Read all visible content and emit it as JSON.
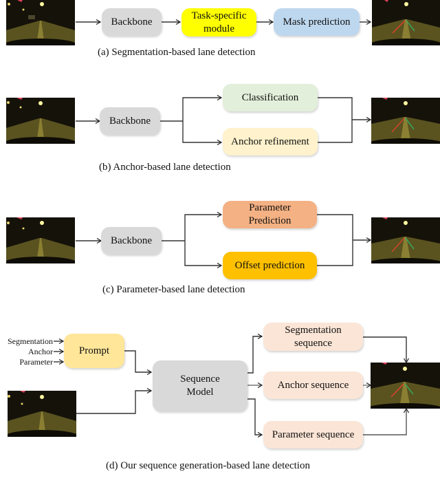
{
  "panel_a": {
    "boxes": {
      "backbone": "Backbone",
      "task_module_line1": "Task-specific",
      "task_module_line2": "module",
      "mask_prediction": "Mask prediction"
    },
    "caption": "(a) Segmentation-based lane detection"
  },
  "panel_b": {
    "boxes": {
      "backbone": "Backbone",
      "classification": "Classification",
      "anchor_refinement": "Anchor refinement"
    },
    "caption": "(b) Anchor-based lane detection"
  },
  "panel_c": {
    "boxes": {
      "backbone": "Backbone",
      "parameter_prediction_line1": "Parameter",
      "parameter_prediction_line2": "Prediction",
      "offset_prediction": "Offset prediction"
    },
    "caption": "(c) Parameter-based lane detection"
  },
  "panel_d": {
    "prompt_inputs": [
      "Segmentation",
      "Anchor",
      "Parameter"
    ],
    "boxes": {
      "prompt": "Prompt",
      "sequence_model_line1": "Sequence",
      "sequence_model_line2": "Model",
      "segmentation_sequence_line1": "Segmentation",
      "segmentation_sequence_line2": "sequence",
      "anchor_sequence": "Anchor sequence",
      "parameter_sequence": "Parameter sequence"
    },
    "caption": "(d) Our sequence generation-based lane detection"
  },
  "colors": {
    "backbone": "#d9d9d9",
    "task_module": "#ffff00",
    "mask_prediction": "#bdd7ee",
    "classification": "#e2efda",
    "anchor_refinement": "#fff2cc",
    "parameter_prediction": "#f4b183",
    "offset_prediction": "#ffc000",
    "prompt": "#ffe699",
    "sequence_boxes": "#fbe5d6",
    "lane_left": "#e8412c",
    "lane_right": "#2fb56a"
  }
}
